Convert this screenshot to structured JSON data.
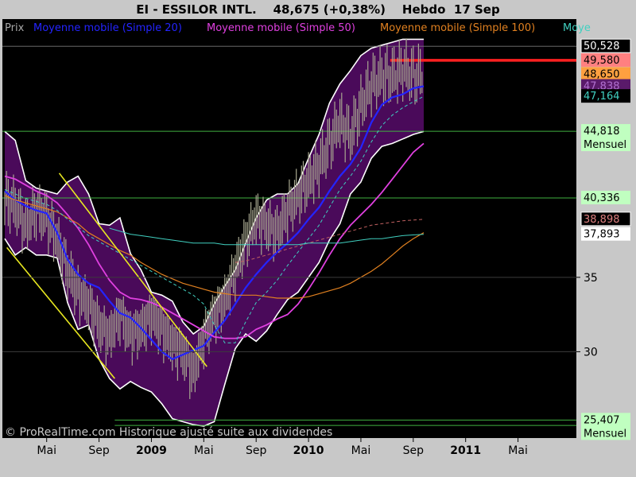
{
  "title": "EI - ESSILOR INTL.    48,675 (+0,38%)    Hebdo  17 Sep",
  "legend": [
    {
      "label": "Prix",
      "color": "#a8a8a8"
    },
    {
      "label": "Moyenne mobile (Simple 20)",
      "color": "#2424ff"
    },
    {
      "label": "Moyenne mobile (Simple 50)",
      "color": "#e040e0"
    },
    {
      "label": "Moyenne mobile (Simple 100)",
      "color": "#e08020"
    },
    {
      "label": "Moye",
      "color": "#40d0c0"
    }
  ],
  "watermark": "© ProRealTime.com Historique ajusté suite aux dividendes",
  "chart_data": {
    "type": "line",
    "ylim": [
      25.0,
      51.5
    ],
    "x_range": [
      0,
      40
    ],
    "y_ticks": [
      35,
      30
    ],
    "x_ticks": [
      {
        "x": 4.0,
        "label": "Mai",
        "bold": false
      },
      {
        "x": 9.0,
        "label": "Sep",
        "bold": false
      },
      {
        "x": 14.0,
        "label": "2009",
        "bold": true
      },
      {
        "x": 19.0,
        "label": "Mai",
        "bold": false
      },
      {
        "x": 24.0,
        "label": "Sep",
        "bold": false
      },
      {
        "x": 29.0,
        "label": "2010",
        "bold": true
      },
      {
        "x": 34.0,
        "label": "Mai",
        "bold": false
      },
      {
        "x": 39.0,
        "label": "Sep",
        "bold": false
      },
      {
        "x": 44.0,
        "label": "2011",
        "bold": true
      },
      {
        "x": 49.0,
        "label": "Mai",
        "bold": false
      }
    ],
    "horizontal_lines": [
      {
        "y": 44.818,
        "color": "#40b040"
      },
      {
        "y": 40.336,
        "color": "#40b040"
      },
      {
        "y": 25.407,
        "color": "#40b040",
        "x_start": 10.5
      },
      {
        "y": 25.05,
        "color": "#40b040",
        "x_start": 10.5
      },
      {
        "y": 49.58,
        "color": "#ff2020",
        "x_start": 36.8,
        "width": 3.5
      },
      {
        "y": 50.528,
        "color": "#7a7a7a",
        "width": 0.8
      }
    ],
    "price_labels": [
      {
        "value": "50,528",
        "y": 50.528,
        "bg": "#000000",
        "fg": "#ffffff",
        "border": "#ffffff"
      },
      {
        "value": "49,580",
        "y": 49.58,
        "bg": "#ff8080",
        "fg": "#000000"
      },
      {
        "value": "48,650",
        "y": 48.65,
        "bg": "#ffa040",
        "fg": "#000000"
      },
      {
        "value": "47,838",
        "y": 47.838,
        "bg": "#5a1a6a",
        "fg": "#b070d0"
      },
      {
        "value": "47,164",
        "y": 47.164,
        "bg": "#000000",
        "fg": "#40d0c0"
      },
      {
        "value": "44,818",
        "sub": "Mensuel",
        "y": 44.818,
        "bg": "#c0ffc0",
        "fg": "#000000"
      },
      {
        "value": "40,336",
        "y": 40.336,
        "bg": "#c0ffc0",
        "fg": "#000000"
      },
      {
        "value": "38,898",
        "y": 38.898,
        "bg": "#000000",
        "fg": "#e08080",
        "border": "#ffffff"
      },
      {
        "value": "37,893",
        "y": 37.893,
        "bg": "#ffffff",
        "fg": "#000000"
      },
      {
        "value": "25,407",
        "sub": "Mensuel",
        "y": 25.407,
        "bg": "#c0ffc0",
        "fg": "#000000"
      }
    ],
    "trend_lines": [
      {
        "x1": 0.2,
        "y1": 37.0,
        "x2": 10.5,
        "y2": 28.2,
        "color": "#e8e820"
      },
      {
        "x1": 5.2,
        "y1": 42.0,
        "x2": 19.3,
        "y2": 29.0,
        "color": "#e8e820"
      }
    ],
    "close": [
      40.2,
      39.8,
      38.4,
      39.5,
      39.0,
      37.5,
      35.5,
      34.0,
      33.2,
      31.8,
      31.0,
      32.5,
      31.2,
      31.5,
      32.5,
      31.5,
      30.5,
      30.0,
      28.5,
      31.0,
      32.5,
      33.5,
      35.5,
      37.5,
      39.0,
      38.5,
      38.0,
      39.5,
      40.5,
      41.5,
      42.5,
      44.0,
      45.5,
      44.5,
      46.5,
      48.0,
      48.5,
      48.5,
      49.0,
      48.5,
      48.675
    ],
    "series": [
      {
        "name": "Moyenne mobile (Simple 20)",
        "color": "#2424ff",
        "width": 2.2,
        "y": [
          40.8,
          40.2,
          39.8,
          39.5,
          39.3,
          38.0,
          36.2,
          35.2,
          34.6,
          34.3,
          33.4,
          32.6,
          32.3,
          31.6,
          30.8,
          30.0,
          29.5,
          29.8,
          30.1,
          30.4,
          31.3,
          32.1,
          33.2,
          34.3,
          35.2,
          36.0,
          36.7,
          37.3,
          38.0,
          38.9,
          39.7,
          40.8,
          41.8,
          42.6,
          43.7,
          45.4,
          46.6,
          47.1,
          47.3,
          47.7,
          47.838
        ]
      },
      {
        "name": "Moyenne mobile (Simple 50)",
        "color": "#e040e0",
        "width": 1.8,
        "y": [
          41.8,
          41.6,
          41.2,
          40.8,
          40.5,
          40.0,
          39.2,
          38.3,
          37.2,
          35.9,
          34.8,
          34.0,
          33.6,
          33.5,
          33.3,
          33.0,
          32.6,
          32.2,
          31.8,
          31.4,
          31.0,
          30.9,
          30.9,
          31.0,
          31.5,
          31.8,
          32.2,
          32.5,
          33.2,
          34.2,
          35.3,
          36.5,
          37.6,
          38.5,
          39.2,
          39.9,
          40.7,
          41.6,
          42.5,
          43.4,
          44.0
        ]
      },
      {
        "name": "Moyenne mobile (Simple 100)",
        "color": "#e08020",
        "width": 1.2,
        "y": [
          40.5,
          40.2,
          40.0,
          39.8,
          39.6,
          39.4,
          39.0,
          38.6,
          38.0,
          37.6,
          37.2,
          36.8,
          36.5,
          36.0,
          35.6,
          35.2,
          34.9,
          34.6,
          34.4,
          34.2,
          34.0,
          33.9,
          33.8,
          33.8,
          33.8,
          33.7,
          33.6,
          33.6,
          33.6,
          33.7,
          33.9,
          34.1,
          34.3,
          34.6,
          35.0,
          35.4,
          35.9,
          36.5,
          37.1,
          37.6,
          38.0
        ]
      },
      {
        "name": "Moyenne mobile (Simple 20) dashed",
        "color": "#40d0c0",
        "width": 1.0,
        "dashed": true,
        "y": [
          40.9,
          40.6,
          40.3,
          40.1,
          39.9,
          39.5,
          38.9,
          38.4,
          37.8,
          37.4,
          37.0,
          36.6,
          36.2,
          35.8,
          35.4,
          35.0,
          34.6,
          34.2,
          33.8,
          33.2,
          31.8,
          30.6,
          30.6,
          32.0,
          33.3,
          34.0,
          34.8,
          35.8,
          36.7,
          37.6,
          38.5,
          39.7,
          40.9,
          41.8,
          42.8,
          44.1,
          45.2,
          45.9,
          46.4,
          46.8,
          47.164
        ]
      },
      {
        "name": "Moyenne mobile (Simple 100) dashed",
        "color": "#c06060",
        "width": 1.0,
        "dashed": true,
        "x_start": 22,
        "y": [
          36.0,
          36.1,
          36.3,
          36.5,
          36.7,
          36.9,
          37.1,
          37.3,
          37.5,
          37.7,
          37.9,
          38.1,
          38.3,
          38.5,
          38.6,
          38.7,
          38.8,
          38.85,
          38.898
        ]
      },
      {
        "name": "Moye",
        "color": "#40d0c0",
        "width": 1.0,
        "x_start": 10,
        "y": [
          38.3,
          38.1,
          37.9,
          37.8,
          37.7,
          37.6,
          37.5,
          37.4,
          37.3,
          37.3,
          37.3,
          37.2,
          37.2,
          37.2,
          37.2,
          37.2,
          37.2,
          37.2,
          37.2,
          37.3,
          37.3,
          37.3,
          37.3,
          37.4,
          37.5,
          37.6,
          37.6,
          37.7,
          37.8,
          37.85,
          37.893
        ]
      }
    ],
    "bands": {
      "color": "#4a0a5a",
      "upper": [
        44.8,
        44.2,
        41.5,
        41.0,
        40.8,
        40.6,
        41.4,
        41.8,
        40.6,
        38.6,
        38.5,
        39.0,
        36.6,
        35.5,
        34.0,
        33.8,
        33.4,
        32.0,
        31.2,
        31.7,
        33.2,
        34.4,
        35.5,
        37.3,
        39.0,
        40.2,
        40.6,
        40.6,
        41.3,
        43.0,
        44.6,
        46.7,
        48.0,
        48.9,
        49.9,
        50.4,
        50.6,
        50.8,
        51.0,
        51.0,
        51.0
      ],
      "lower": [
        37.6,
        36.5,
        37.0,
        36.5,
        36.5,
        36.3,
        33.3,
        31.5,
        31.8,
        29.5,
        28.2,
        27.5,
        28.0,
        27.6,
        27.3,
        26.5,
        25.5,
        25.3,
        25.1,
        25.0,
        25.3,
        27.8,
        30.2,
        31.2,
        30.7,
        31.4,
        32.5,
        33.5,
        34.0,
        35.0,
        36.0,
        37.5,
        38.6,
        40.6,
        41.4,
        43.0,
        43.8,
        44.0,
        44.3,
        44.6,
        44.8
      ]
    }
  }
}
